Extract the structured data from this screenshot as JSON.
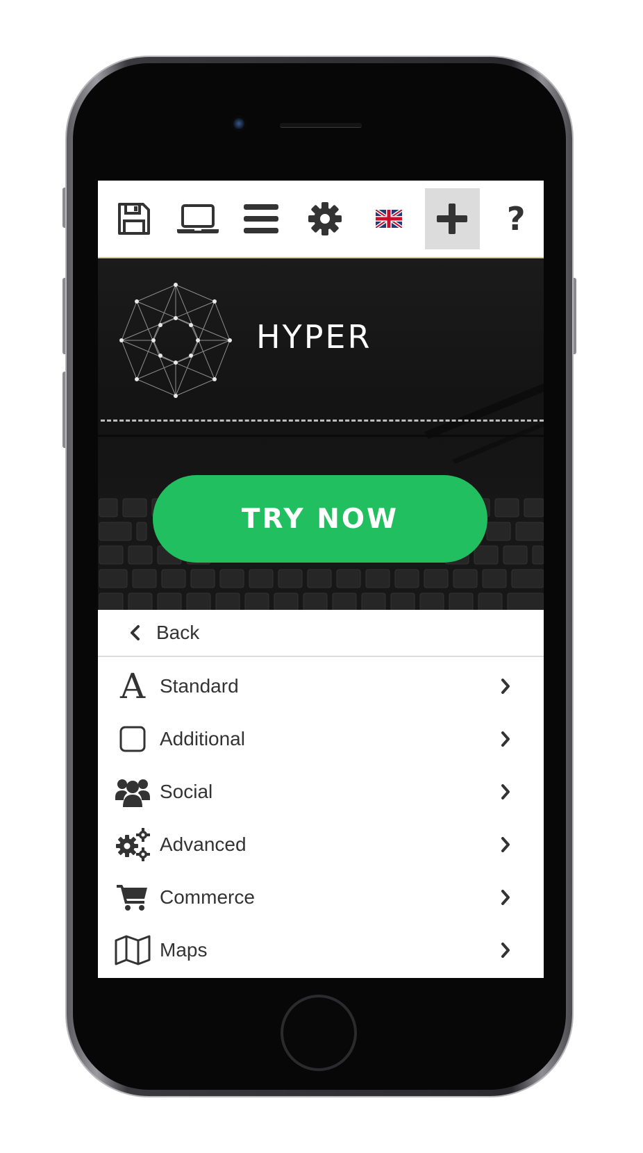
{
  "toolbar": {
    "items": [
      {
        "icon": "save-icon"
      },
      {
        "icon": "laptop-icon"
      },
      {
        "icon": "menu-icon"
      },
      {
        "icon": "gear-icon"
      },
      {
        "icon": "uk-flag-icon"
      },
      {
        "icon": "plus-icon",
        "active": true
      },
      {
        "icon": "help-icon"
      }
    ],
    "help_glyph": "?"
  },
  "hero": {
    "brand": "HYPER",
    "cta_label": "TRY NOW",
    "cta_color": "#21bf5f"
  },
  "menu": {
    "back_label": "Back",
    "items": [
      {
        "label": "Standard",
        "icon": "font-icon"
      },
      {
        "label": "Additional",
        "icon": "square-icon"
      },
      {
        "label": "Social",
        "icon": "users-icon"
      },
      {
        "label": "Advanced",
        "icon": "gears-icon"
      },
      {
        "label": "Commerce",
        "icon": "cart-icon"
      },
      {
        "label": "Maps",
        "icon": "map-icon"
      }
    ]
  }
}
